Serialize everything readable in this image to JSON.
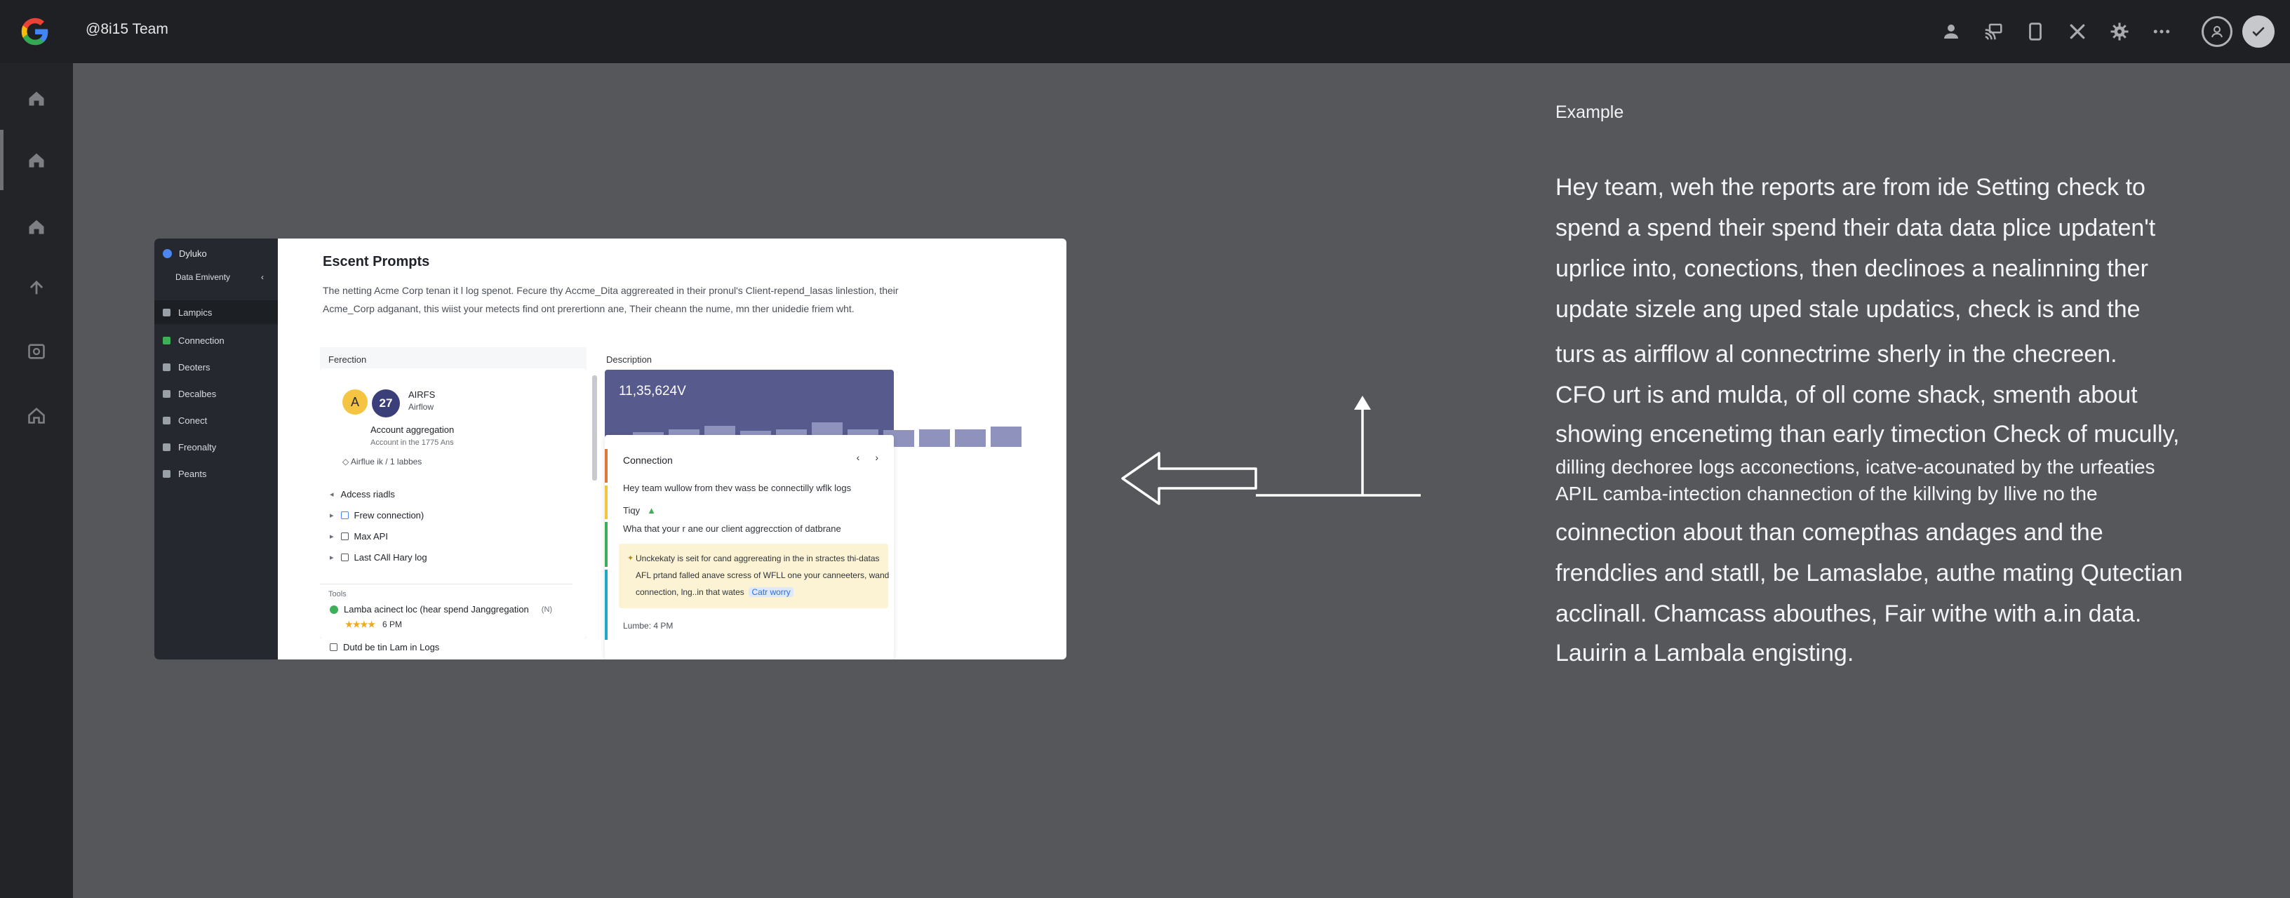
{
  "header": {
    "workspace": "@8i15 Team",
    "icons": [
      "person-icon",
      "cast-icon",
      "document-icon",
      "close-icon",
      "gear-icon",
      "more-icon",
      "account-icon",
      "check-icon"
    ]
  },
  "rail": {
    "icons": [
      "home-icon",
      "home-icon",
      "home-icon",
      "upload-icon",
      "image-icon",
      "home-icon"
    ]
  },
  "card": {
    "sidebar": {
      "brand": "Dyluko",
      "sub": "Data Emiventy",
      "items": [
        "Lampics",
        "Connection",
        "Deoters",
        "Decalbes",
        "Conect",
        "Freonalty",
        "Peants"
      ]
    },
    "title": "Escent Prompts",
    "desc_line1": "The netting Acme Corp tenan it l log spenot. Fecure thy Accme_Dita aggrereated in their pronul's Client-repend_lasas linlestion, their",
    "desc_line2": "Acme_Corp adganant, this wiist your metects find ont prerertionn ane, Their cheann the nume, mn ther unidedie friem wht.",
    "left_panel": {
      "heading": "Ferection",
      "avatar_a": "A",
      "avatar_b": "27",
      "name": "AIRFS",
      "name_sub": "Airflow",
      "item_title": "Account aggregation",
      "item_sub": "Account in the 1775 Ans",
      "item_meta": "Airflue ik / 1 labbes",
      "rows": [
        "Adcess riadls",
        "Frew connection)",
        "Max API",
        "Last CAll Hary log"
      ],
      "tools_label": "Tools",
      "lambda_row": "Lamba acinect loc (hear spend Janggregation",
      "lambda_count": "(N)",
      "stars": "★★★★",
      "stars_time": "6 PM",
      "last_row": "Dutd be tin Lam in Logs"
    },
    "right_panel": {
      "heading": "Description",
      "value": "11,35,624V",
      "bar_levels": [
        0.35,
        0.42,
        0.5,
        0.38,
        0.42,
        0.58,
        0.42,
        0.4,
        0.42,
        0.42,
        0.48
      ],
      "section_title": "Connection",
      "nav_prev": "‹",
      "nav_next": "›",
      "line1": "Hey team wullow from thev wass be connectilly wflk logs",
      "line2": "Tiqy",
      "line3": "Wha that your r ane our client aggrecction of datbrane",
      "note_line1": "Unckekaty is seit for cand aggrereating in the in stractes thi-datas",
      "note_line2": "AFL prtand falled anave scress of WFLL one your canneeters, wand",
      "note_line3": "connection, lng..in that wates",
      "note_tag": "Catr worry",
      "footer": "Lumbe: 4 PM",
      "accent_colors": [
        "#e2763a",
        "#f0c542",
        "#3fae59",
        "#21a7c8"
      ]
    }
  },
  "example": {
    "label": "Example",
    "lines": [
      "Hey team, weh the reports are from ide Setting check to",
      "spend a spend their spend their data data plice updaten't",
      "uprlice into, conections, then declinoes a nealinning ther",
      "update sizele ang uped stale updatics,  check is and the",
      "turs as airfflow al connectrime sherly in the checreen.",
      "CFO urt is and mulda, of oll come shack, smenth about",
      "showing encenetimg than early timection Check of mucully,",
      "dilling dechoree logs acconections, icatve-acounated by the urfeaties",
      "APIL camba-intection channection of the killving by llive no the",
      "coinnection about than comepthas andages and the",
      "frendclies and statll, be Lamaslabe, authe mating Qutectian",
      "acclinall. Chamcass abouthes, Fair withe with a.in data.",
      "Lauirin a Lambala engisting."
    ]
  },
  "colors": {
    "topbar": "#1f2023",
    "rail": "#232427",
    "canvas": "#56575b",
    "card_sidebar": "#25292f",
    "banner": "#565a8c"
  }
}
